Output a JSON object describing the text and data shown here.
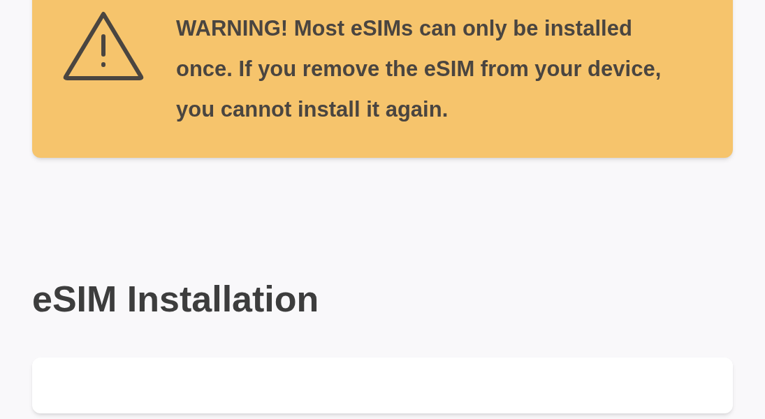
{
  "warning": {
    "text": "WARNING! Most eSIMs can only be installed once. If you remove the eSIM from your device, you cannot install it again."
  },
  "section": {
    "title": "eSIM Installation"
  }
}
